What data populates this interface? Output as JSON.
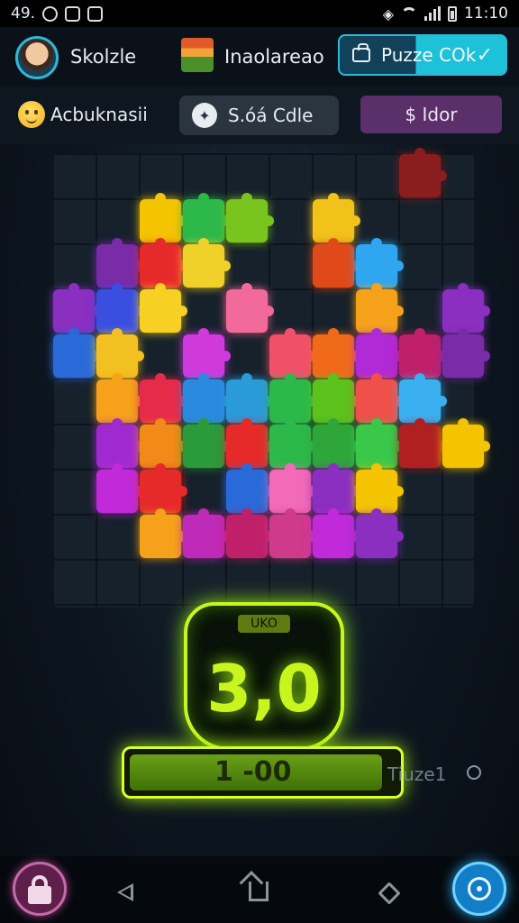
{
  "status_bar": {
    "time_left": "49.",
    "time_right": "11:10"
  },
  "header": {
    "user_name": "Skolzle",
    "app_title": "Inaolareao",
    "puzzle_button": "Puzze COk"
  },
  "toolbar": {
    "user_label": "Acbuknasii",
    "code_button": "S.óá Cdle",
    "idor_button": "$ Idor"
  },
  "score": {
    "tag": "UKO",
    "value": "3,0",
    "progress_label": "1 -00",
    "progress_fraction": 0.95,
    "side_note": "Tiuze1"
  },
  "colors": {
    "accent_green": "#c9f51e",
    "accent_cyan": "#2fb7d8",
    "board_bg": "#16212b"
  },
  "icons": [
    "avatar-icon",
    "app-icon",
    "lock-icon",
    "home-icon",
    "back-icon",
    "recent-icon",
    "target-icon"
  ],
  "board": {
    "tiles": [
      {
        "c": 2,
        "r": 1,
        "color": "#f5c400"
      },
      {
        "c": 3,
        "r": 1,
        "color": "#2db84a"
      },
      {
        "c": 4,
        "r": 1,
        "color": "#7ac51d"
      },
      {
        "c": 6,
        "r": 1,
        "color": "#f1c21a"
      },
      {
        "c": 8,
        "r": 0,
        "color": "#8a1e1e"
      },
      {
        "c": 1,
        "r": 2,
        "color": "#7a2ba8"
      },
      {
        "c": 2,
        "r": 2,
        "color": "#e62a2a"
      },
      {
        "c": 3,
        "r": 2,
        "color": "#f0d12a"
      },
      {
        "c": 6,
        "r": 2,
        "color": "#e04a1a"
      },
      {
        "c": 7,
        "r": 2,
        "color": "#2fa6f0"
      },
      {
        "c": 0,
        "r": 3,
        "color": "#8a2fc0"
      },
      {
        "c": 1,
        "r": 3,
        "color": "#3a4fe0"
      },
      {
        "c": 2,
        "r": 3,
        "color": "#f7d024"
      },
      {
        "c": 4,
        "r": 3,
        "color": "#f26a9a"
      },
      {
        "c": 7,
        "r": 3,
        "color": "#f5a21a"
      },
      {
        "c": 9,
        "r": 3,
        "color": "#8a2fc0"
      },
      {
        "c": 0,
        "r": 4,
        "color": "#2a6ad8"
      },
      {
        "c": 1,
        "r": 4,
        "color": "#f2c020"
      },
      {
        "c": 3,
        "r": 4,
        "color": "#d03adc"
      },
      {
        "c": 5,
        "r": 4,
        "color": "#f0506a"
      },
      {
        "c": 6,
        "r": 4,
        "color": "#f06a1a"
      },
      {
        "c": 7,
        "r": 4,
        "color": "#b02ad8"
      },
      {
        "c": 8,
        "r": 4,
        "color": "#c0206a"
      },
      {
        "c": 9,
        "r": 4,
        "color": "#7a2ba8"
      },
      {
        "c": 1,
        "r": 5,
        "color": "#f5a21a"
      },
      {
        "c": 2,
        "r": 5,
        "color": "#e62a4a"
      },
      {
        "c": 3,
        "r": 5,
        "color": "#2a8ae0"
      },
      {
        "c": 4,
        "r": 5,
        "color": "#2a9ad8"
      },
      {
        "c": 5,
        "r": 5,
        "color": "#2db84a"
      },
      {
        "c": 6,
        "r": 5,
        "color": "#5cc21d"
      },
      {
        "c": 7,
        "r": 5,
        "color": "#f0504a"
      },
      {
        "c": 8,
        "r": 5,
        "color": "#3ab0f0"
      },
      {
        "c": 1,
        "r": 6,
        "color": "#a02ad0"
      },
      {
        "c": 2,
        "r": 6,
        "color": "#f28a1a"
      },
      {
        "c": 3,
        "r": 6,
        "color": "#2a9a3a"
      },
      {
        "c": 4,
        "r": 6,
        "color": "#e62a2a"
      },
      {
        "c": 5,
        "r": 6,
        "color": "#2db84a"
      },
      {
        "c": 6,
        "r": 6,
        "color": "#2fa63a"
      },
      {
        "c": 7,
        "r": 6,
        "color": "#3ac84a"
      },
      {
        "c": 8,
        "r": 6,
        "color": "#b02020"
      },
      {
        "c": 9,
        "r": 6,
        "color": "#f5c400"
      },
      {
        "c": 1,
        "r": 7,
        "color": "#c02ad8"
      },
      {
        "c": 2,
        "r": 7,
        "color": "#e62a2a"
      },
      {
        "c": 4,
        "r": 7,
        "color": "#2a6ad8"
      },
      {
        "c": 5,
        "r": 7,
        "color": "#f26ab8"
      },
      {
        "c": 6,
        "r": 7,
        "color": "#8a2fc0"
      },
      {
        "c": 7,
        "r": 7,
        "color": "#f5c400"
      },
      {
        "c": 2,
        "r": 8,
        "color": "#f5a21a"
      },
      {
        "c": 3,
        "r": 8,
        "color": "#c02ab8"
      },
      {
        "c": 4,
        "r": 8,
        "color": "#c0206a"
      },
      {
        "c": 5,
        "r": 8,
        "color": "#d03a8a"
      },
      {
        "c": 6,
        "r": 8,
        "color": "#c02ad8"
      },
      {
        "c": 7,
        "r": 8,
        "color": "#8a2fc0"
      }
    ]
  }
}
